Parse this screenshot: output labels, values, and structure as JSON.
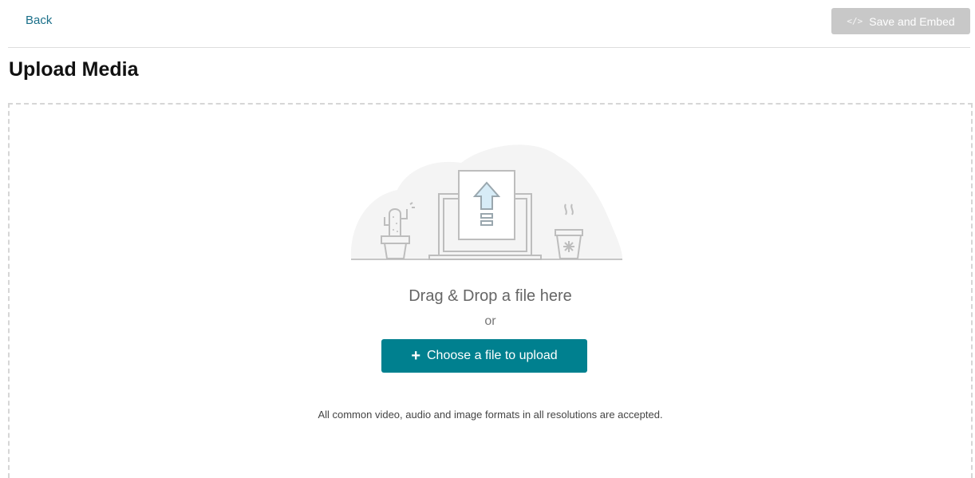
{
  "header": {
    "back_label": "Back",
    "save_embed_label": "Save and Embed",
    "save_embed_icon": "code-icon"
  },
  "page": {
    "title": "Upload Media"
  },
  "dropzone": {
    "illustration_icon": "upload-illustration-icon",
    "drag_text": "Drag & Drop a file here",
    "or_text": "or",
    "choose_label": "Choose a file to upload",
    "choose_icon": "plus-icon",
    "formats_text": "All common video, audio and image formats in all resolutions are accepted."
  },
  "colors": {
    "accent": "#00808f",
    "link": "#1a6f89",
    "disabled_button": "#c8c8c8"
  }
}
